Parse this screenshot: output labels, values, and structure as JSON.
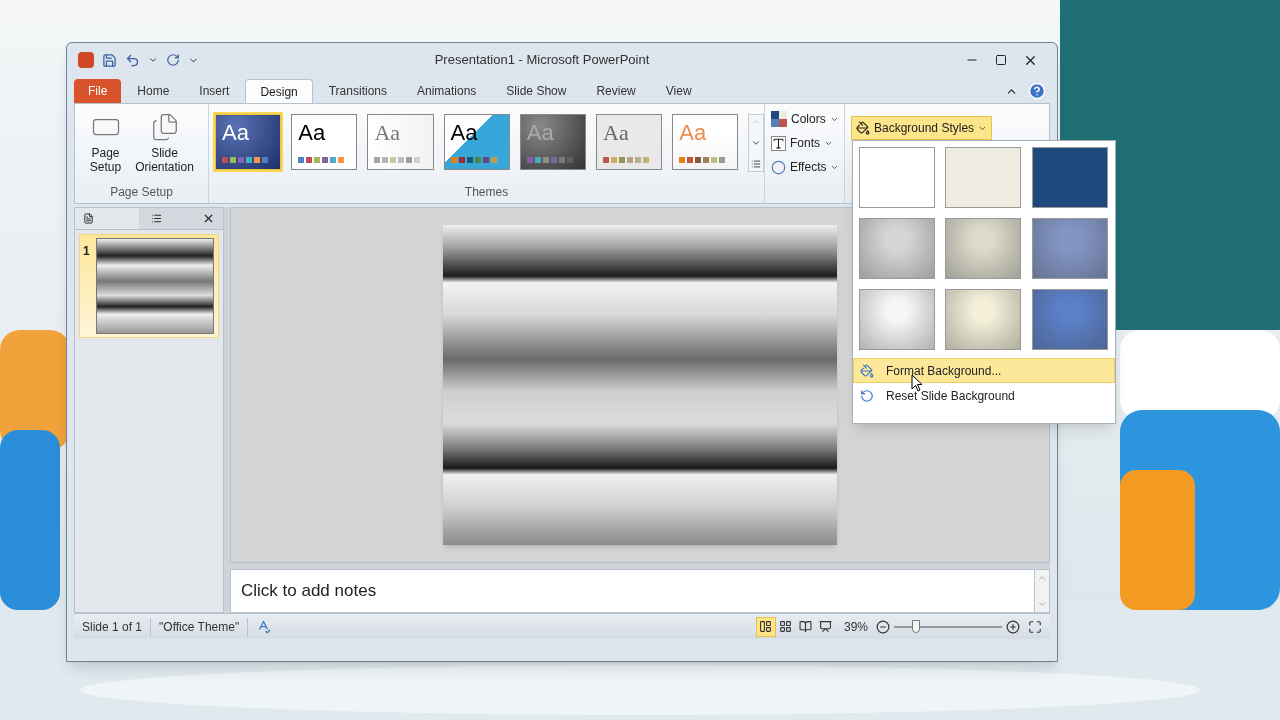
{
  "window": {
    "title": "Presentation1 - Microsoft PowerPoint"
  },
  "tabs": [
    {
      "label": "File",
      "kind": "file",
      "selected": false
    },
    {
      "label": "Home",
      "kind": "tab",
      "selected": false
    },
    {
      "label": "Insert",
      "kind": "tab",
      "selected": false
    },
    {
      "label": "Design",
      "kind": "tab",
      "selected": true
    },
    {
      "label": "Transitions",
      "kind": "tab",
      "selected": false
    },
    {
      "label": "Animations",
      "kind": "tab",
      "selected": false
    },
    {
      "label": "Slide Show",
      "kind": "tab",
      "selected": false
    },
    {
      "label": "Review",
      "kind": "tab",
      "selected": false
    },
    {
      "label": "View",
      "kind": "tab",
      "selected": false
    }
  ],
  "page_setup": {
    "buttons": [
      {
        "label": "Page Setup",
        "kind": "page"
      },
      {
        "label": "Slide Orientation",
        "kind": "orientation"
      }
    ],
    "group_label": "Page Setup"
  },
  "themes": {
    "items": [
      {
        "sample": "Aa",
        "kind": "navy",
        "selected": true
      },
      {
        "sample": "Aa",
        "kind": "plain",
        "selected": false
      },
      {
        "sample": "Aa",
        "kind": "classic",
        "selected": false
      },
      {
        "sample": "Aa",
        "kind": "angles",
        "selected": false
      },
      {
        "sample": "Aa",
        "kind": "grey",
        "selected": false
      },
      {
        "sample": "Aa",
        "kind": "paper",
        "selected": false
      },
      {
        "sample": "Aa",
        "kind": "orange",
        "selected": false
      }
    ],
    "group_label": "Themes"
  },
  "design_options": [
    {
      "label": "Colors",
      "kind": "colors"
    },
    {
      "label": "Fonts",
      "kind": "fonts"
    },
    {
      "label": "Effects",
      "kind": "effects"
    }
  ],
  "background_styles": {
    "label": "Background Styles",
    "expanded": true
  },
  "background_menu": {
    "swatches": [
      {
        "kind": "solid",
        "color": "#ffffff"
      },
      {
        "kind": "solid",
        "color": "#eeece1"
      },
      {
        "kind": "solid",
        "color": "#1f497d"
      },
      {
        "kind": "gradient",
        "color": "#d6d6d6"
      },
      {
        "kind": "gradient",
        "color": "#dcdacb"
      },
      {
        "kind": "gradient",
        "color": "#8295c4"
      },
      {
        "kind": "gradient",
        "color": "#f6f6f6"
      },
      {
        "kind": "gradient",
        "color": "#f3efd8"
      },
      {
        "kind": "gradient",
        "color": "#5b7fc8"
      }
    ],
    "items": [
      {
        "label": "Format Background...",
        "kind": "format",
        "selected": true
      },
      {
        "label": "Reset Slide Background",
        "kind": "reset",
        "selected": false
      }
    ]
  },
  "slides_panel": {
    "thumbnails": [
      {
        "number": "1",
        "selected": true
      }
    ]
  },
  "notes": {
    "placeholder": "Click to add notes"
  },
  "status_bar": {
    "slide": "Slide 1 of 1",
    "theme": "\"Office Theme\"",
    "views": [
      {
        "kind": "normal",
        "selected": true
      },
      {
        "kind": "sorter",
        "selected": false
      },
      {
        "kind": "reading",
        "selected": false
      },
      {
        "kind": "slideshow",
        "selected": false
      }
    ],
    "zoom": "39%",
    "zoom_slider": {
      "level": 0.2
    }
  }
}
